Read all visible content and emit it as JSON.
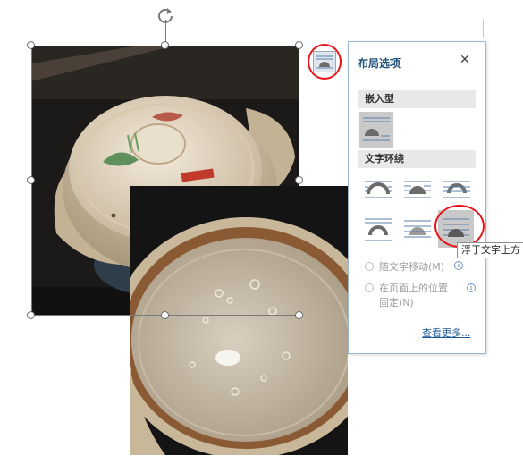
{
  "panel": {
    "title": "布局选项",
    "close_glyph": "✕",
    "section_inline": "嵌入型",
    "section_wrap": "文字环绕",
    "radio_move_with_text": "随文字移动(M)",
    "radio_fix_position_line1": "在页面上的位置",
    "radio_fix_position_line2": "固定(N)",
    "see_more": "查看更多..."
  },
  "tooltip": {
    "text": "浮于文字上方"
  },
  "icons": {
    "rotate": "rotate-handle-icon",
    "layout": "layout-options-icon",
    "info": "info-icon"
  },
  "colors": {
    "highlight_circle": "#e8141b",
    "panel_title": "#1f4e79",
    "link": "#1f5c99",
    "selected_option": "#c9c9c9"
  }
}
